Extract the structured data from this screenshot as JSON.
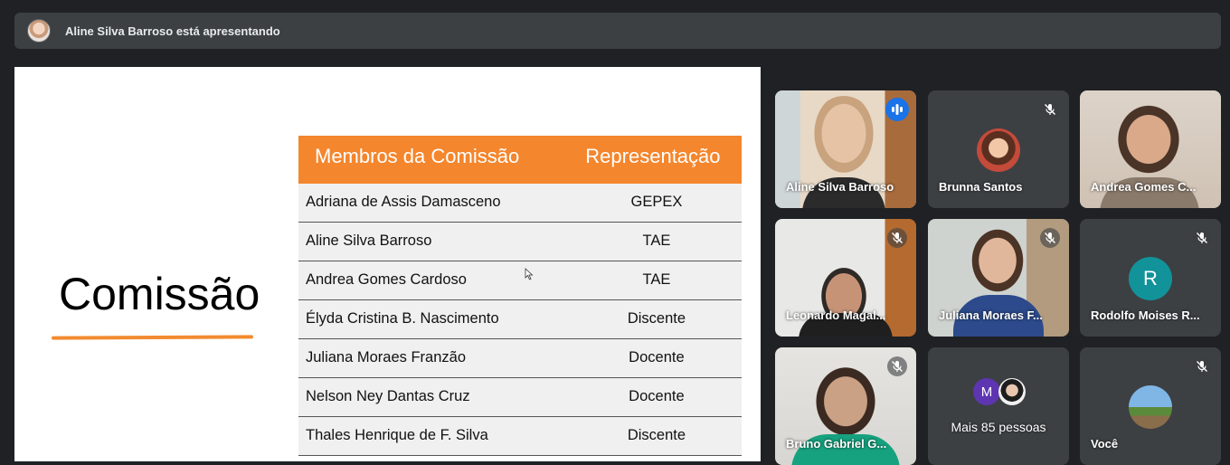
{
  "presenter_bar": {
    "title": "Aline Silva Barroso está apresentando"
  },
  "slide": {
    "heading": "Comissão",
    "accent_color": "#f4862d",
    "table": {
      "headers": [
        "Membros da Comissão",
        "Representação"
      ],
      "rows": [
        [
          "Adriana de Assis Damasceno",
          "GEPEX"
        ],
        [
          "Aline Silva Barroso",
          "TAE"
        ],
        [
          "Andrea Gomes Cardoso",
          "TAE"
        ],
        [
          "Élyda Cristina B. Nascimento",
          "Discente"
        ],
        [
          "Juliana Moraes Franzão",
          "Docente"
        ],
        [
          "Nelson Ney Dantas Cruz",
          "Docente"
        ],
        [
          "Thales Henrique de F. Silva",
          "Discente"
        ]
      ]
    }
  },
  "participants": [
    {
      "name": "Aline Silva Barroso",
      "mic": "speaking"
    },
    {
      "name": "Brunna Santos",
      "mic": "muted"
    },
    {
      "name": "Andrea Gomes C...",
      "mic": "none"
    },
    {
      "name": "Leonardo Magal...",
      "mic": "muted"
    },
    {
      "name": "Juliana Moraes F...",
      "mic": "muted"
    },
    {
      "name": "Rodolfo Moises R...",
      "mic": "muted",
      "initial": "R",
      "avatar_color": "#12939a"
    },
    {
      "name": "Bruno Gabriel G...",
      "mic": "muted"
    },
    {
      "name": "Mais 85 pessoas",
      "initial": "M",
      "avatar_color": "#5e35b1"
    },
    {
      "name": "Você",
      "mic": "muted"
    }
  ]
}
